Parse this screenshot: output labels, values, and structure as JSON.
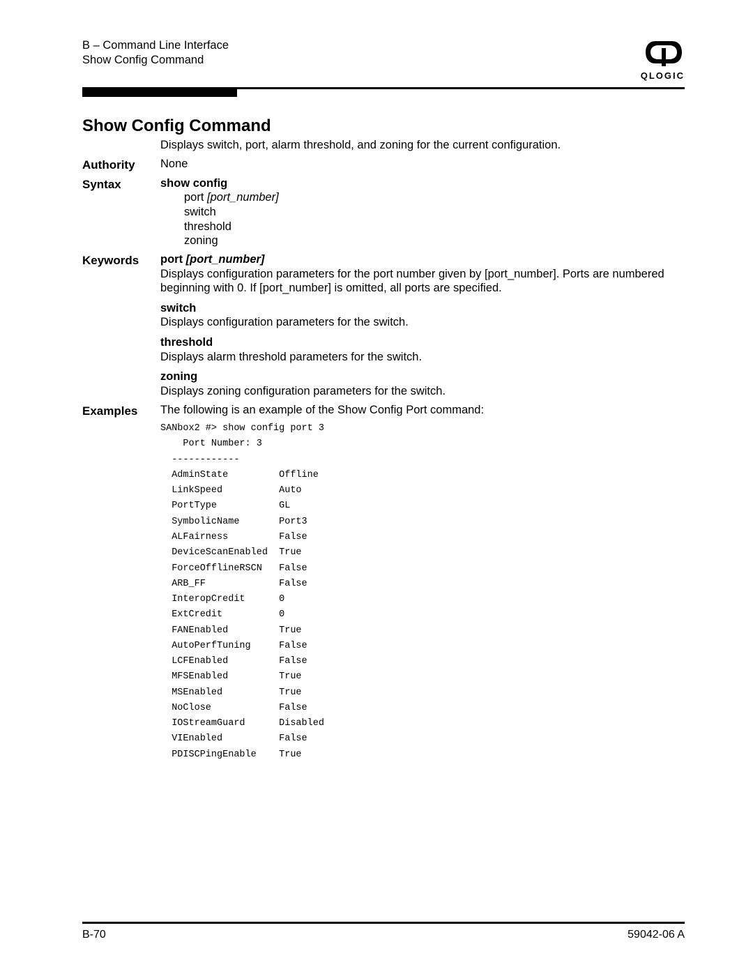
{
  "header": {
    "section": "B – Command Line Interface",
    "page_title": "Show Config Command",
    "logo_word": "QLOGIC"
  },
  "title": "Show Config Command",
  "intro": "Displays switch, port, alarm threshold, and zoning for the current configuration.",
  "authority": {
    "label": "Authority",
    "value": "None"
  },
  "syntax": {
    "label": "Syntax",
    "cmd": "show config",
    "arg1_prefix": "port ",
    "arg1_param": "[port_number]",
    "arg2": "switch",
    "arg3": "threshold",
    "arg4": "zoning"
  },
  "keywords": {
    "label": "Keywords",
    "k1_prefix": "port ",
    "k1_param": "[port_number]",
    "k1_desc": "Displays configuration parameters for the port number given by [port_number]. Ports are numbered beginning with 0. If [port_number] is omitted, all ports are specified.",
    "k2": "switch",
    "k2_desc": "Displays configuration parameters for the switch.",
    "k3": "threshold",
    "k3_desc": "Displays alarm threshold parameters for the switch.",
    "k4": "zoning",
    "k4_desc": "Displays zoning configuration parameters for the switch."
  },
  "examples": {
    "label": "Examples",
    "intro": "The following is an example of the Show Config Port command:",
    "output": "SANbox2 #> show config port 3\n    Port Number: 3\n  ------------\n  AdminState         Offline\n  LinkSpeed          Auto\n  PortType           GL\n  SymbolicName       Port3\n  ALFairness         False\n  DeviceScanEnabled  True\n  ForceOfflineRSCN   False\n  ARB_FF             False\n  InteropCredit      0\n  ExtCredit          0\n  FANEnabled         True\n  AutoPerfTuning     False\n  LCFEnabled         False\n  MFSEnabled         True\n  MSEnabled          True\n  NoClose            False\n  IOStreamGuard      Disabled\n  VIEnabled          False\n  PDISCPingEnable    True"
  },
  "footer": {
    "left": "B-70",
    "right": "59042-06  A"
  }
}
